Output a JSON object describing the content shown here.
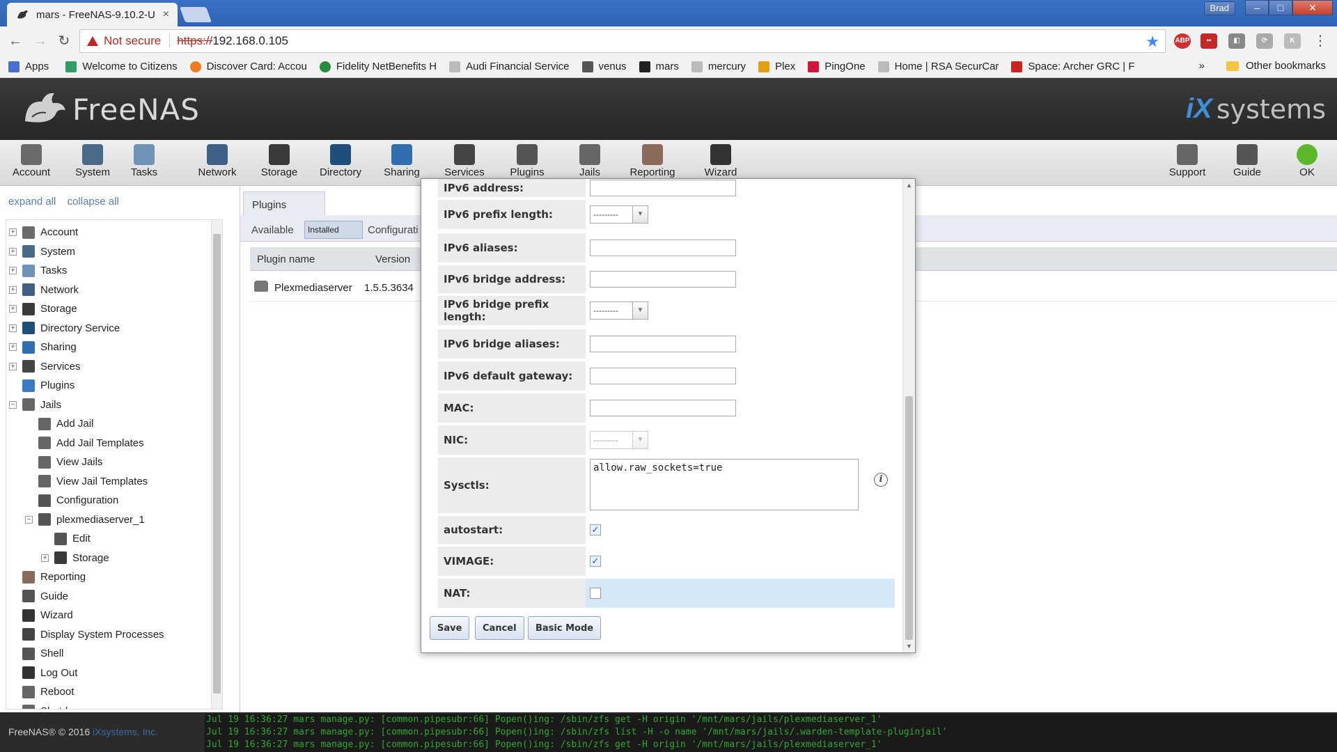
{
  "browser": {
    "tab_title": "mars - FreeNAS-9.10.2-U",
    "tab_close": "×",
    "user": "Brad",
    "window_controls": {
      "minimize": "–",
      "maximize": "□",
      "close": "✕"
    },
    "security_label": "Not secure",
    "url_scheme": "https://",
    "url_host": "192.168.0.105",
    "bookmarks": [
      {
        "label": "Apps",
        "icon": "apps-grid-icon",
        "color": "#4a6fd0"
      },
      {
        "label": "Welcome to Citizens",
        "icon": "citizens-icon",
        "color": "#2f9e6a"
      },
      {
        "label": "Discover Card: Accou",
        "icon": "discover-icon",
        "color": "#f47a20"
      },
      {
        "label": "Fidelity NetBenefits H",
        "icon": "fidelity-icon",
        "color": "#2c8a3c"
      },
      {
        "label": "Audi Financial Service",
        "icon": "page-icon",
        "color": "#bbbbbb"
      },
      {
        "label": "venus",
        "icon": "freenas-icon",
        "color": "#555555"
      },
      {
        "label": "mars",
        "icon": "freenas-icon",
        "color": "#222222"
      },
      {
        "label": "mercury",
        "icon": "page-icon",
        "color": "#bbbbbb"
      },
      {
        "label": "Plex",
        "icon": "plex-icon",
        "color": "#e5a00d"
      },
      {
        "label": "PingOne",
        "icon": "pingone-icon",
        "color": "#d0143a"
      },
      {
        "label": "Home | RSA SecurCar",
        "icon": "page-icon",
        "color": "#bbbbbb"
      },
      {
        "label": "Space: Archer GRC | F",
        "icon": "rsa-icon",
        "color": "#cc2222"
      }
    ],
    "bookmarks_more": "»",
    "other_bookmarks": "Other bookmarks"
  },
  "header": {
    "brand": "FreeNAS",
    "vendor_mark": "iX",
    "vendor_text": "systems"
  },
  "nav": [
    {
      "label": "Account",
      "icon": "account-icon",
      "color": "#6b6b6b"
    },
    {
      "label": "System",
      "icon": "system-icon",
      "color": "#4a6a8a"
    },
    {
      "label": "Tasks",
      "icon": "tasks-icon",
      "color": "#6f93b8"
    },
    {
      "label": "Network",
      "icon": "network-icon",
      "color": "#3f5f86"
    },
    {
      "label": "Storage",
      "icon": "storage-icon",
      "color": "#3a3a3a"
    },
    {
      "label": "Directory",
      "icon": "directory-icon",
      "color": "#1f4e7a"
    },
    {
      "label": "Sharing",
      "icon": "sharing-icon",
      "color": "#2f6fb0"
    },
    {
      "label": "Services",
      "icon": "services-icon",
      "color": "#444444"
    },
    {
      "label": "Plugins",
      "icon": "plugins-icon",
      "color": "#555555"
    },
    {
      "label": "Jails",
      "icon": "jails-icon",
      "color": "#666666"
    },
    {
      "label": "Reporting",
      "icon": "reporting-icon",
      "color": "#8a6a5a"
    },
    {
      "label": "Wizard",
      "icon": "wizard-icon",
      "color": "#333333"
    },
    {
      "label": "Support",
      "icon": "support-icon",
      "color": "#666666"
    },
    {
      "label": "Guide",
      "icon": "guide-icon",
      "color": "#555555"
    },
    {
      "label": "OK",
      "icon": "status-ok-icon",
      "color": "#5cb82a"
    }
  ],
  "sidebar": {
    "expand_all": "expand all",
    "collapse_all": "collapse all",
    "items": [
      {
        "label": "Account",
        "exp": "+",
        "icon": "account-icon",
        "color": "#6b6b6b"
      },
      {
        "label": "System",
        "exp": "+",
        "icon": "system-icon",
        "color": "#4a6a8a"
      },
      {
        "label": "Tasks",
        "exp": "+",
        "icon": "tasks-icon",
        "color": "#6f93b8"
      },
      {
        "label": "Network",
        "exp": "+",
        "icon": "network-icon",
        "color": "#3f5f86"
      },
      {
        "label": "Storage",
        "exp": "+",
        "icon": "storage-icon",
        "color": "#3a3a3a"
      },
      {
        "label": "Directory Service",
        "exp": "+",
        "icon": "directory-icon",
        "color": "#1f4e7a"
      },
      {
        "label": "Sharing",
        "exp": "+",
        "icon": "sharing-icon",
        "color": "#2f6fb0"
      },
      {
        "label": "Services",
        "exp": "+",
        "icon": "services-icon",
        "color": "#444444"
      },
      {
        "label": "Plugins",
        "exp": "",
        "icon": "plugins-icon",
        "color": "#3a7bc8"
      },
      {
        "label": "Jails",
        "exp": "−",
        "icon": "jails-icon",
        "color": "#666666"
      },
      {
        "label": "Add Jail",
        "exp": "",
        "icon": "jails-icon",
        "color": "#666666"
      },
      {
        "label": "Add Jail Templates",
        "exp": "",
        "icon": "jails-icon",
        "color": "#666666"
      },
      {
        "label": "View Jails",
        "exp": "",
        "icon": "jails-icon",
        "color": "#666666"
      },
      {
        "label": "View Jail Templates",
        "exp": "",
        "icon": "jails-icon",
        "color": "#666666"
      },
      {
        "label": "Configuration",
        "exp": "",
        "icon": "wrench-icon",
        "color": "#555555"
      },
      {
        "label": "plexmediaserver_1",
        "exp": "−",
        "icon": "plugin-jail-icon",
        "color": "#555555"
      },
      {
        "label": "Edit",
        "exp": "",
        "icon": "wrench-icon",
        "color": "#555555"
      },
      {
        "label": "Storage",
        "exp": "+",
        "icon": "storage-icon",
        "color": "#3a3a3a"
      },
      {
        "label": "Reporting",
        "exp": "",
        "icon": "reporting-icon",
        "color": "#8a6a5a"
      },
      {
        "label": "Guide",
        "exp": "",
        "icon": "guide-icon",
        "color": "#555555"
      },
      {
        "label": "Wizard",
        "exp": "",
        "icon": "wizard-icon",
        "color": "#333333"
      },
      {
        "label": "Display System Processes",
        "exp": "",
        "icon": "processes-icon",
        "color": "#444444"
      },
      {
        "label": "Shell",
        "exp": "",
        "icon": "shell-icon",
        "color": "#555555"
      },
      {
        "label": "Log Out",
        "exp": "",
        "icon": "logout-icon",
        "color": "#333333"
      },
      {
        "label": "Reboot",
        "exp": "",
        "icon": "reboot-icon",
        "color": "#666666"
      },
      {
        "label": "Shutdown",
        "exp": "",
        "icon": "shutdown-icon",
        "color": "#666666"
      }
    ]
  },
  "plugins_panel": {
    "tab": "Plugins",
    "subtabs": [
      "Available",
      "Installed",
      "Configurati"
    ],
    "columns": [
      "Plugin name",
      "Version"
    ],
    "rows": [
      {
        "name": "Plexmediaserver",
        "version": "1.5.5.3634"
      }
    ]
  },
  "modal": {
    "fields": [
      {
        "label": "IPv6 address:",
        "type": "text",
        "value": ""
      },
      {
        "label": "IPv6 prefix length:",
        "type": "select",
        "value": "---------"
      },
      {
        "label": "IPv6 aliases:",
        "type": "text",
        "value": ""
      },
      {
        "label": "IPv6 bridge address:",
        "type": "text",
        "value": ""
      },
      {
        "label": "IPv6 bridge prefix length:",
        "type": "select",
        "value": "---------"
      },
      {
        "label": "IPv6 bridge aliases:",
        "type": "text",
        "value": ""
      },
      {
        "label": "IPv6 default gateway:",
        "type": "text",
        "value": ""
      },
      {
        "label": "MAC:",
        "type": "text",
        "value": ""
      },
      {
        "label": "NIC:",
        "type": "select",
        "value": "---------",
        "disabled": true
      },
      {
        "label": "Sysctls:",
        "type": "textarea",
        "value": "allow.raw_sockets=true"
      },
      {
        "label": "autostart:",
        "type": "checkbox",
        "checked": true
      },
      {
        "label": "VIMAGE:",
        "type": "checkbox",
        "checked": true
      },
      {
        "label": "NAT:",
        "type": "checkbox",
        "checked": false
      }
    ],
    "info_glyph": "i",
    "buttons": {
      "save": "Save",
      "cancel": "Cancel",
      "basic": "Basic Mode"
    }
  },
  "footer": {
    "copyright": "FreeNAS® © 2016",
    "vendor_link": "iXsystems, Inc.",
    "log": [
      "Jul 19 16:36:27 mars manage.py: [common.pipesubr:66] Popen()ing: /sbin/zfs get -H origin '/mnt/mars/jails/plexmediaserver_1'",
      "Jul 19 16:36:27 mars manage.py: [common.pipesubr:66] Popen()ing: /sbin/zfs list -H -o name '/mnt/mars/jails/.warden-template-pluginjail'",
      "Jul 19 16:36:27 mars manage.py: [common.pipesubr:66] Popen()ing: /sbin/zfs get -H origin '/mnt/mars/jails/plexmediaserver_1'"
    ]
  },
  "colors": {
    "accent": "#3d8fd6",
    "header_bg": "#2e2e2e",
    "log_green": "#2fa82f",
    "highlight_row": "#d6e7f8"
  }
}
